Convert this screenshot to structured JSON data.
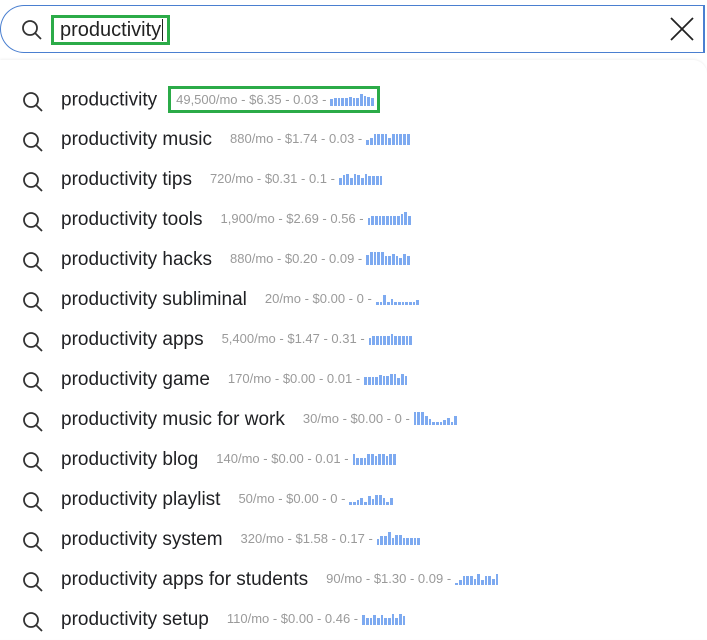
{
  "search": {
    "query": "productivity",
    "search_icon": "search-icon",
    "clear_icon": "close-icon"
  },
  "colors": {
    "highlight": "#2bab48",
    "sparkline": "#7eaaf0",
    "border": "#4a7fd0"
  },
  "suggestions": [
    {
      "keyword": "productivity",
      "metrics": "49,500/mo - $6.35 - 0.03 -",
      "trend": [
        50,
        55,
        60,
        55,
        60,
        65,
        55,
        60,
        85,
        70,
        65,
        60
      ],
      "highlighted": true
    },
    {
      "keyword": "productivity music",
      "metrics": "880/mo - $1.74 - 0.03 -",
      "trend": [
        45,
        60,
        90,
        90,
        90,
        90,
        60,
        85,
        90,
        90,
        90,
        90
      ]
    },
    {
      "keyword": "productivity tips",
      "metrics": "720/mo - $0.31 - 0.1 -",
      "trend": [
        55,
        80,
        90,
        60,
        90,
        80,
        60,
        90,
        75,
        75,
        75,
        75
      ]
    },
    {
      "keyword": "productivity tools",
      "metrics": "1,900/mo - $2.69 - 0.56 -",
      "trend": [
        60,
        70,
        70,
        70,
        70,
        70,
        70,
        75,
        70,
        90,
        100,
        70
      ]
    },
    {
      "keyword": "productivity hacks",
      "metrics": "880/mo - $0.20 - 0.09 -",
      "trend": [
        80,
        100,
        100,
        100,
        100,
        70,
        70,
        90,
        70,
        60,
        90,
        70
      ]
    },
    {
      "keyword": "productivity subliminal",
      "metrics": "20/mo - $0.00 - 0 -",
      "trend": [
        30,
        25,
        80,
        30,
        50,
        30,
        30,
        25,
        25,
        25,
        25,
        40
      ]
    },
    {
      "keyword": "productivity apps",
      "metrics": "5,400/mo - $1.47 - 0.31 -",
      "trend": [
        60,
        70,
        70,
        70,
        70,
        75,
        90,
        70,
        75,
        70,
        70,
        70
      ]
    },
    {
      "keyword": "productivity game",
      "metrics": "170/mo - $0.00 - 0.01 -",
      "trend": [
        65,
        65,
        65,
        65,
        80,
        70,
        70,
        85,
        90,
        60,
        90,
        70
      ]
    },
    {
      "keyword": "productivity music for work",
      "metrics": "30/mo - $0.00 - 0 -",
      "trend": [
        100,
        100,
        100,
        70,
        50,
        30,
        30,
        25,
        45,
        60,
        30,
        70
      ]
    },
    {
      "keyword": "productivity blog",
      "metrics": "140/mo - $0.00 - 0.01 -",
      "trend": [
        90,
        60,
        60,
        60,
        90,
        90,
        70,
        90,
        90,
        70,
        90,
        90
      ]
    },
    {
      "keyword": "productivity playlist",
      "metrics": "50/mo - $0.00 - 0 -",
      "trend": [
        30,
        30,
        45,
        60,
        30,
        70,
        50,
        80,
        80,
        60,
        30,
        60
      ]
    },
    {
      "keyword": "productivity system",
      "metrics": "320/mo - $1.58 - 0.17 -",
      "trend": [
        50,
        75,
        75,
        100,
        60,
        80,
        80,
        60,
        60,
        60,
        60,
        60
      ]
    },
    {
      "keyword": "productivity apps for students",
      "metrics": "90/mo - $1.30 - 0.09 -",
      "trend": [
        20,
        45,
        70,
        75,
        75,
        50,
        90,
        45,
        70,
        70,
        50,
        90
      ]
    },
    {
      "keyword": "productivity setup",
      "metrics": "110/mo - $0.00 - 0.46 -",
      "trend": [
        80,
        60,
        60,
        80,
        60,
        80,
        60,
        60,
        90,
        60,
        90,
        70
      ]
    }
  ]
}
